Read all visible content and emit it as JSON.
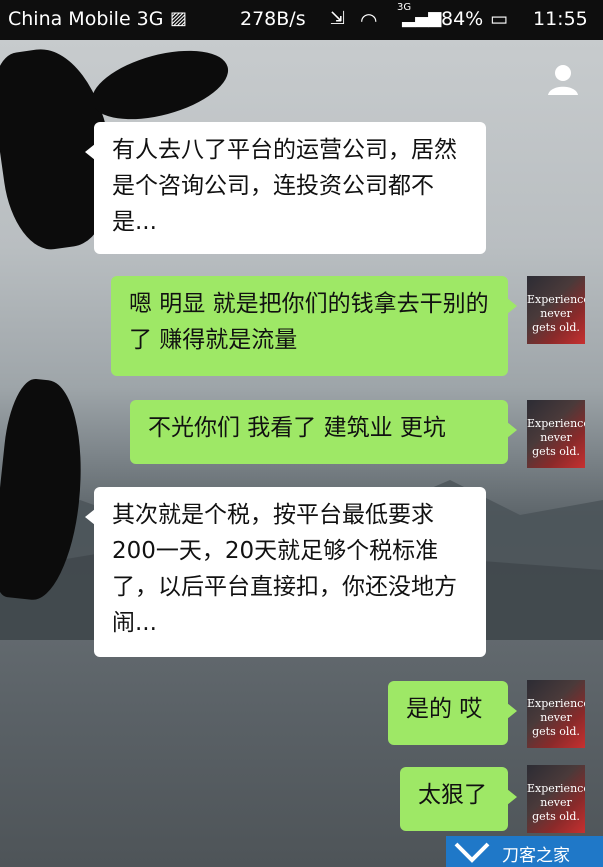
{
  "status_bar": {
    "carrier": "China Mobile 3G",
    "speed": "278B/s",
    "net": "3G",
    "battery": "84%",
    "time": "11:55"
  },
  "messages": [
    {
      "side": "left",
      "text": "有人去八了平台的运营公司，居然是个咨询公司，连投资公司都不是..."
    },
    {
      "side": "right",
      "text": "嗯  明显  就是把你们的钱拿去干别的了  赚得就是流量"
    },
    {
      "side": "right",
      "text": "不光你们  我看了  建筑业  更坑"
    },
    {
      "side": "left",
      "text": "其次就是个税，按平台最低要求200一天，20天就足够个税标准了，以后平台直接扣，你还没地方闹..."
    },
    {
      "side": "right",
      "text": "是的  哎"
    },
    {
      "side": "right",
      "text": "太狠了"
    }
  ],
  "avatar_text": [
    "Experience",
    "never",
    "gets old."
  ],
  "watermark": "刀客之家"
}
